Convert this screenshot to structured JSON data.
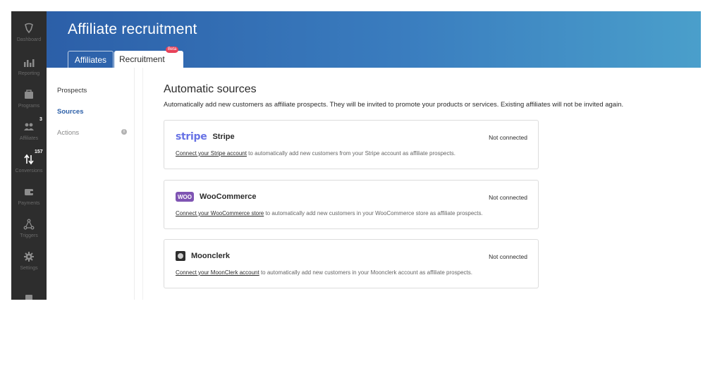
{
  "nav": {
    "items": [
      {
        "label": "Dashboard",
        "icon": "dashboard-icon",
        "badge": ""
      },
      {
        "label": "Reporting",
        "icon": "reporting-icon",
        "badge": ""
      },
      {
        "label": "Programs",
        "icon": "programs-icon",
        "badge": ""
      },
      {
        "label": "Affiliates",
        "icon": "affiliates-icon",
        "badge": "3"
      },
      {
        "label": "Conversions",
        "icon": "conversions-icon",
        "badge": "157"
      },
      {
        "label": "Payments",
        "icon": "payments-icon",
        "badge": ""
      },
      {
        "label": "Triggers",
        "icon": "triggers-icon",
        "badge": ""
      },
      {
        "label": "Settings",
        "icon": "settings-icon",
        "badge": ""
      }
    ]
  },
  "header": {
    "title": "Affiliate recruitment",
    "tabs": [
      {
        "label": "Affiliates",
        "active": false
      },
      {
        "label": "Recruitment",
        "active": true,
        "badge": "Beta"
      }
    ]
  },
  "subnav": {
    "items": [
      {
        "label": "Prospects"
      },
      {
        "label": "Sources",
        "active": true
      },
      {
        "label": "Actions"
      }
    ]
  },
  "main": {
    "title": "Automatic sources",
    "description": "Automatically add new customers as affiliate prospects. They will be invited to promote your products or services. Existing affiliates will not be invited again.",
    "sources": [
      {
        "logo": "stripe",
        "name": "Stripe",
        "status": "Not connected",
        "link": "Connect your Stripe account",
        "text": " to automatically add new customers from your Stripe account as affiliate prospects."
      },
      {
        "logo": "WOO",
        "name": "WooCommerce",
        "status": "Not connected",
        "link": "Connect your WooCommerce store",
        "text": " to automatically add new customers in your WooCommerce store as affiliate prospects."
      },
      {
        "logo": "mooncleck",
        "name": "Moonclerk",
        "status": "Not connected",
        "link": "Connect your MoonClerk account",
        "text": " to automatically add new customers in your Moonclerk account as affiliate prospects."
      }
    ]
  },
  "colors": {
    "nav_bg": "#2d2d2d",
    "header_start": "#2c5fa8",
    "header_end": "#4a9fcb",
    "accent": "#2c5fa8",
    "beta": "#e8435a",
    "stripe": "#6772e5",
    "woo": "#7f54b3"
  }
}
